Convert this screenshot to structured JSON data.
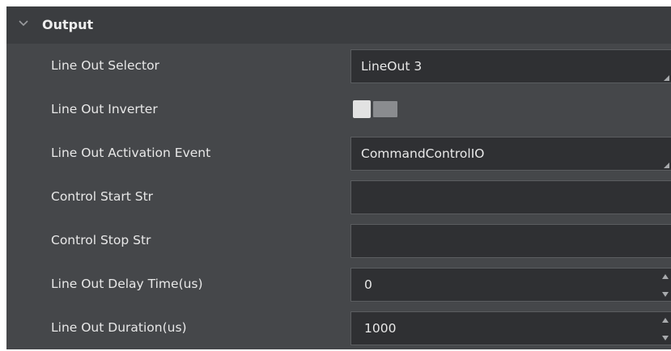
{
  "section": {
    "title": "Output",
    "expand_icon": "chevron-down-icon"
  },
  "rows": [
    {
      "label": "Line Out Selector",
      "control": "dropdown",
      "value": "LineOut 3"
    },
    {
      "label": "Line Out Inverter",
      "control": "toggle",
      "value": "off"
    },
    {
      "label": "Line Out Activation Event",
      "control": "dropdown",
      "value": "CommandControlIO"
    },
    {
      "label": "Control Start Str",
      "control": "text",
      "value": ""
    },
    {
      "label": "Control Stop Str",
      "control": "text",
      "value": ""
    },
    {
      "label": "Line Out Delay Time(us)",
      "control": "spinbox",
      "value": "0"
    },
    {
      "label": "Line Out Duration(us)",
      "control": "spinbox",
      "value": "1000"
    }
  ],
  "colors": {
    "panel_bg": "#45474a",
    "header_bg": "#3b3d40",
    "field_bg": "#2f3033",
    "text": "#e8e8e8"
  }
}
